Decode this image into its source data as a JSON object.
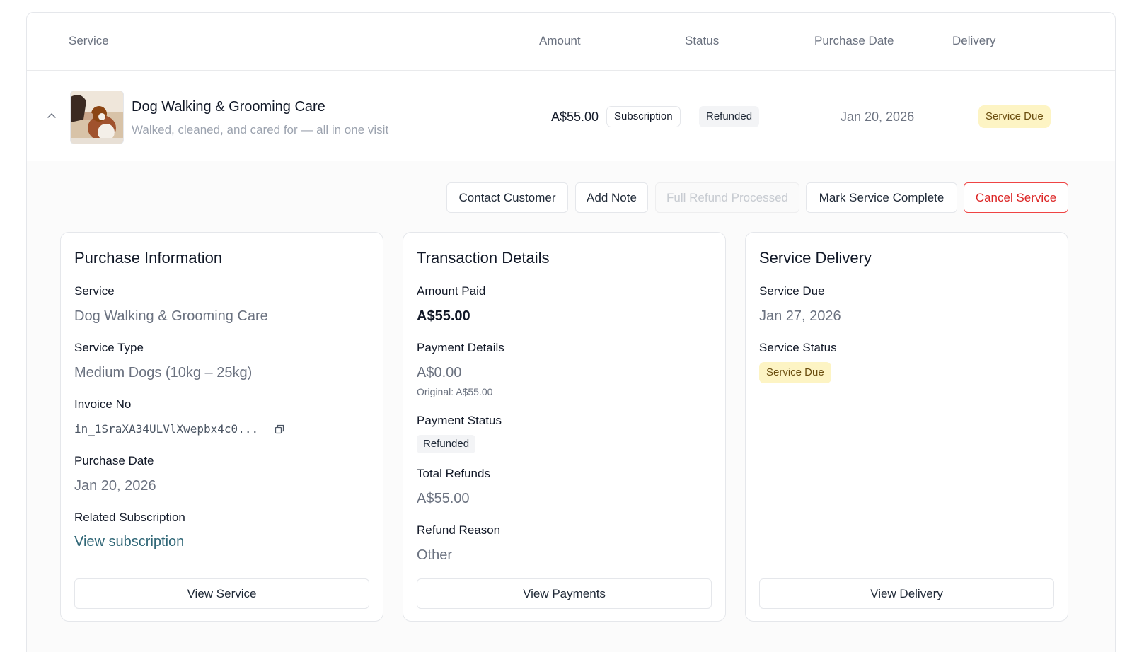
{
  "table": {
    "headers": {
      "service": "Service",
      "amount": "Amount",
      "status": "Status",
      "purchase_date": "Purchase Date",
      "delivery": "Delivery"
    },
    "row": {
      "title": "Dog Walking & Grooming Care",
      "subtitle": "Walked, cleaned, and cared for — all in one visit",
      "amount": "A$55.00",
      "billing_type": "Subscription",
      "status": "Refunded",
      "purchase_date": "Jan 20, 2026",
      "delivery": "Service Due"
    }
  },
  "actions": {
    "contact": "Contact Customer",
    "note": "Add Note",
    "refund": "Full Refund Processed",
    "complete": "Mark Service Complete",
    "cancel": "Cancel Service"
  },
  "purchase_info": {
    "title": "Purchase Information",
    "service_label": "Service",
    "service_value": "Dog Walking & Grooming Care",
    "type_label": "Service Type",
    "type_value": "Medium Dogs (10kg – 25kg)",
    "invoice_label": "Invoice No",
    "invoice_value": "in_1SraXA34ULVlXwepbx4c0...",
    "date_label": "Purchase Date",
    "date_value": "Jan 20, 2026",
    "related_label": "Related Subscription",
    "related_link": "View subscription",
    "button": "View Service"
  },
  "transaction": {
    "title": "Transaction Details",
    "amount_label": "Amount Paid",
    "amount_value": "A$55.00",
    "payment_label": "Payment Details",
    "payment_value": "A$0.00",
    "payment_original": "Original: A$55.00",
    "status_label": "Payment Status",
    "status_value": "Refunded",
    "refunds_label": "Total Refunds",
    "refunds_value": "A$55.00",
    "reason_label": "Refund Reason",
    "reason_value": "Other",
    "button": "View Payments"
  },
  "delivery": {
    "title": "Service Delivery",
    "due_label": "Service Due",
    "due_value": "Jan 27, 2026",
    "status_label": "Service Status",
    "status_value": "Service Due",
    "button": "View Delivery"
  },
  "colors": {
    "accent_link": "#2f6676",
    "danger": "#dc2626",
    "due_badge_bg": "#fdf4c4",
    "refunded_badge_bg": "#f3f4f6"
  },
  "icons": {
    "expand": "chevron-up-icon",
    "copy": "copy-icon"
  }
}
